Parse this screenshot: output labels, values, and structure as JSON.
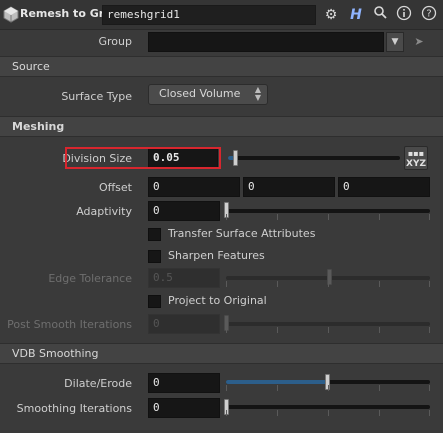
{
  "header": {
    "node_type": "Remesh to Grid",
    "node_name": "remeshgrid1",
    "icons": [
      "gear-icon",
      "help-h-icon",
      "search-icon",
      "info-icon",
      "question-icon"
    ]
  },
  "group": {
    "label": "Group",
    "value": ""
  },
  "source": {
    "section_label": "Source",
    "surface_type_label": "Surface Type",
    "surface_type_value": "Closed Volume"
  },
  "meshing": {
    "section_label": "Meshing",
    "division_size_label": "Division Size",
    "division_size_value": "0.05",
    "division_size_level": 0.05,
    "offset_label": "Offset",
    "offset_values": [
      "0",
      "0",
      "0"
    ],
    "adaptivity_label": "Adaptivity",
    "adaptivity_value": "0",
    "transfer_label": "Transfer Surface Attributes",
    "sharpen_label": "Sharpen Features",
    "edge_tolerance_label": "Edge Tolerance",
    "edge_tolerance_value": "0.5",
    "project_label": "Project to Original",
    "post_smooth_label": "Post Smooth Iterations",
    "post_smooth_value": "0"
  },
  "vdb": {
    "section_label": "VDB Smoothing",
    "dilate_label": "Dilate/Erode",
    "dilate_value": "0",
    "dilate_level": 0.5,
    "smoothing_label": "Smoothing Iterations",
    "smoothing_value": "0"
  },
  "xyz_button": {
    "top": "▪▪▪",
    "bottom": "XYZ"
  },
  "colors": {
    "highlight": "#d8262e",
    "slider_fill": "#2c5e8a",
    "panel": "#3a3a3a"
  }
}
